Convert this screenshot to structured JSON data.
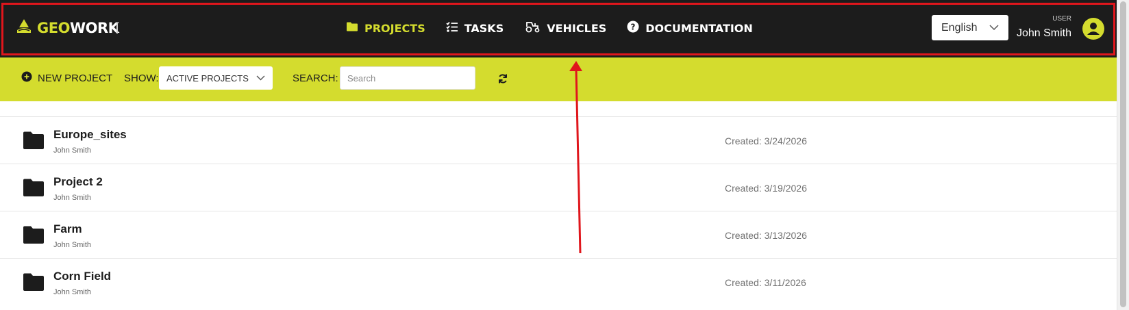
{
  "header": {
    "logo_geo": "GEO",
    "logo_work": "WORK",
    "nav": [
      {
        "label": "PROJECTS",
        "icon": "folder-icon",
        "active": true
      },
      {
        "label": "TASKS",
        "icon": "checklist-icon",
        "active": false
      },
      {
        "label": "VEHICLES",
        "icon": "tractor-icon",
        "active": false
      },
      {
        "label": "DOCUMENTATION",
        "icon": "help-circle-icon",
        "active": false
      }
    ],
    "language": "English",
    "user_role": "USER",
    "user_name": "John Smith"
  },
  "toolbar": {
    "new_project_label": "NEW PROJECT",
    "show_label": "SHOW:",
    "show_value": "ACTIVE PROJECTS",
    "search_label": "SEARCH:",
    "search_placeholder": "Search",
    "search_value": ""
  },
  "projects": [
    {
      "name": "Europe_sites",
      "owner": "John Smith",
      "created": "Created: 3/24/2026"
    },
    {
      "name": "Project 2",
      "owner": "John Smith",
      "created": "Created: 3/19/2026"
    },
    {
      "name": "Farm",
      "owner": "John Smith",
      "created": "Created: 3/13/2026"
    },
    {
      "name": "Corn Field",
      "owner": "John Smith",
      "created": "Created: 3/11/2026"
    }
  ],
  "colors": {
    "accent": "#d4dc2e",
    "header_bg": "#1c1c1c",
    "annotation": "#e0161c"
  }
}
